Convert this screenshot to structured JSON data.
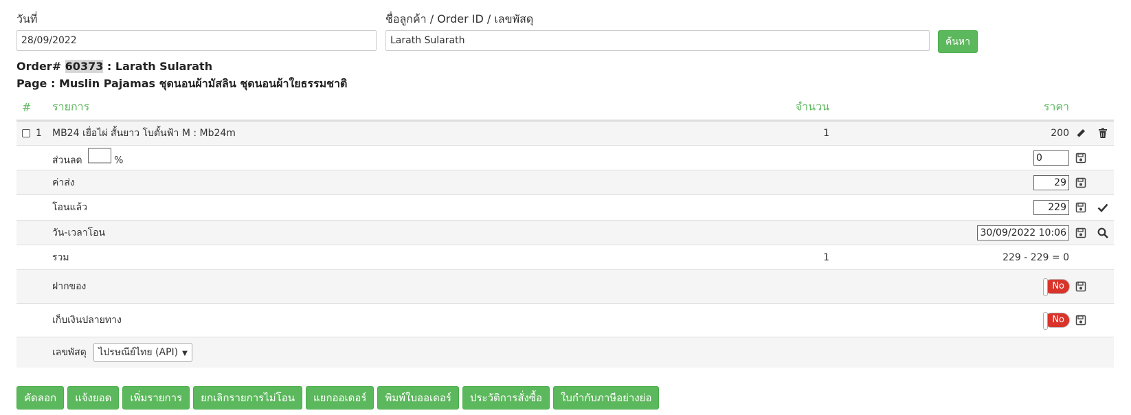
{
  "filters": {
    "date_label": "วันที่",
    "date_value": "28/09/2022",
    "customer_label": "ชื่อลูกค้า / Order ID / เลขพัสดุ",
    "customer_value": "Larath Sularath",
    "search_button": "ค้นหา"
  },
  "order": {
    "prefix": "Order# ",
    "id": "60373",
    "name_part": " : Larath Sularath",
    "page_line": "Page : Muslin Pajamas ชุดนอนผ้ามัสลิน ชุดนอนผ้าใยธรรมชาติ"
  },
  "table": {
    "headers": {
      "hash": "#",
      "item": "รายการ",
      "qty": "จำนวน",
      "price": "ราคา"
    },
    "item_row": {
      "index": "1",
      "name": "MB24 เยื่อไผ่ สั้นยาว โบตั้นฟ้า M : Mb24m",
      "qty": "1",
      "price": "200"
    },
    "discount": {
      "label": "ส่วนลด",
      "percent_value": "",
      "percent_sign": "%",
      "value": "0"
    },
    "shipping": {
      "label": "ค่าส่ง",
      "value": "29"
    },
    "paid": {
      "label": "โอนแล้ว",
      "value": "229"
    },
    "transfer_time": {
      "label": "วัน-เวลาโอน",
      "value": "30/09/2022 10:06"
    },
    "total": {
      "label": "รวม",
      "qty": "1",
      "summary": "229 - 229 = 0"
    },
    "deposit": {
      "label": "ฝากของ",
      "toggle": "No"
    },
    "cod": {
      "label": "เก็บเงินปลายทาง",
      "toggle": "No"
    },
    "tracking": {
      "label": "เลขพัสดุ",
      "carrier": "ไปรษณีย์ไทย (API)"
    }
  },
  "actions": [
    "คัดลอก",
    "แจ้งยอด",
    "เพิ่มรายการ",
    "ยกเลิกรายการไม่โอน",
    "แยกออเดอร์",
    "พิมพ์ใบออเดอร์",
    "ประวัติการสั่งซื้อ",
    "ใบกำกับภาษีอย่างย่อ"
  ],
  "colors": {
    "accent": "#5cb85c",
    "danger": "#d9342b",
    "stripe": "#f5f5f5"
  },
  "icons": [
    "pencil-icon",
    "trash-icon",
    "save-icon",
    "check-icon",
    "search-icon"
  ]
}
